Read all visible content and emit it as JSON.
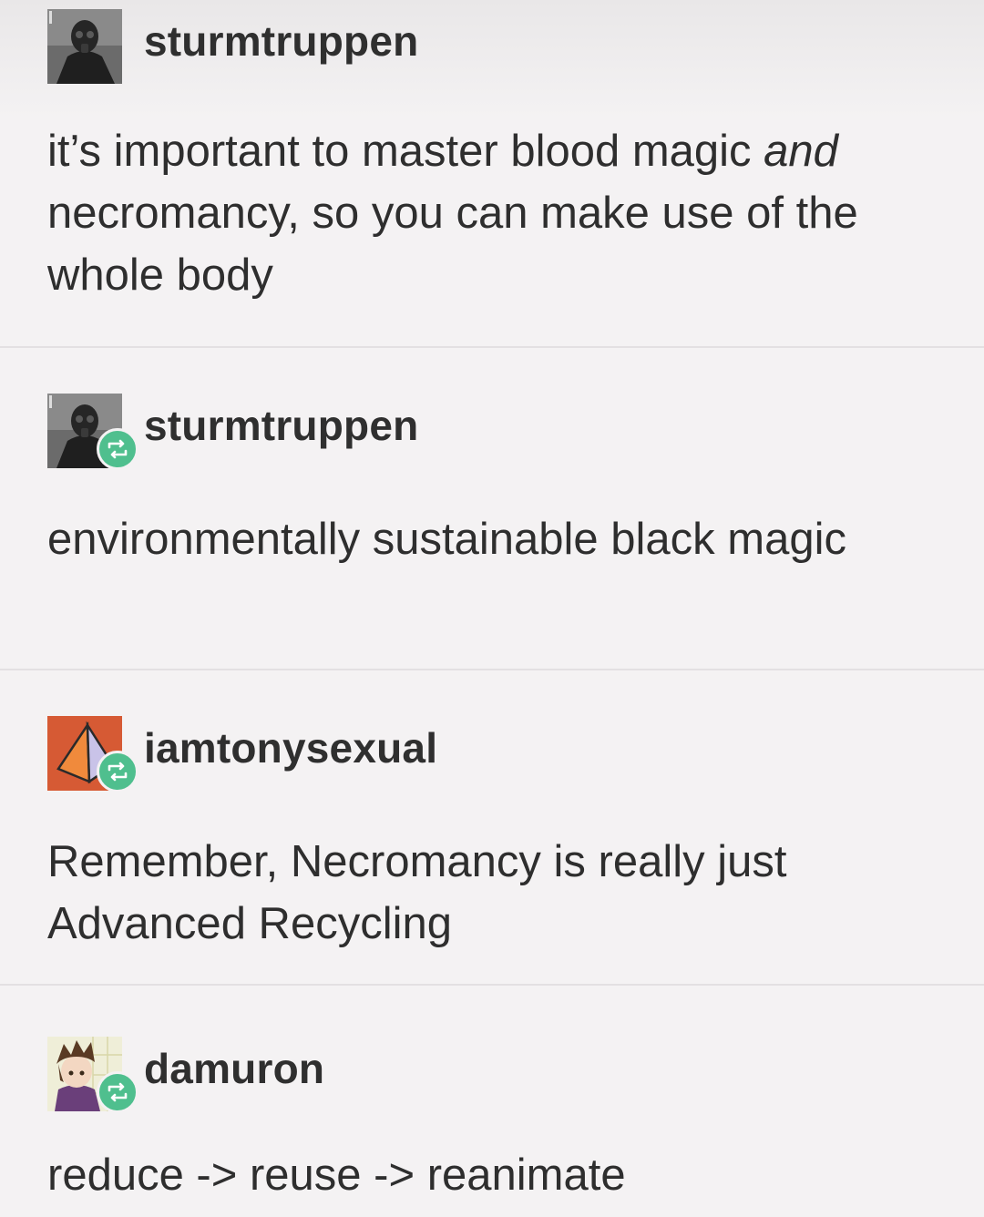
{
  "posts": [
    {
      "username": "sturmtruppen",
      "avatar": "gas-mask-avatar",
      "reblog": false,
      "body_prefix": "it’s important to master blood magic ",
      "body_emphasis": "and",
      "body_suffix": " necromancy, so you can make use of the whole body"
    },
    {
      "username": "sturmtruppen",
      "avatar": "gas-mask-avatar",
      "reblog": true,
      "body": "environmentally sustainable black magic"
    },
    {
      "username": "iamtonysexual",
      "avatar": "orange-pyramid-avatar",
      "reblog": true,
      "body": "Remember, Necromancy is really just Advanced Recycling"
    },
    {
      "username": "damuron",
      "avatar": "anime-character-avatar",
      "reblog": true,
      "body": "reduce -> reuse -> reanimate"
    }
  ],
  "icons": {
    "reblog": "reblog-icon"
  },
  "colors": {
    "reblog_badge": "#4fbf8e",
    "background": "#f4f2f3",
    "text": "#2e2e2e"
  }
}
